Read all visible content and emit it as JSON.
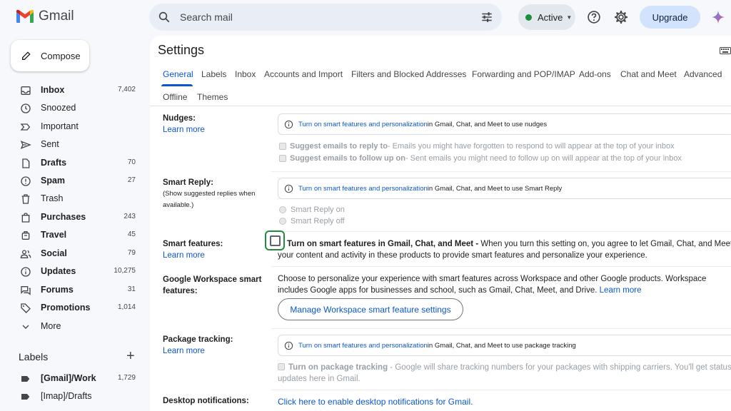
{
  "header": {
    "app_name": "Gmail",
    "search_placeholder": "Search mail",
    "status": "Active",
    "upgrade_label": "Upgrade"
  },
  "sidebar": {
    "compose_label": "Compose",
    "items": [
      {
        "label": "Inbox",
        "count": "7,402",
        "bold": true
      },
      {
        "label": "Snoozed",
        "count": "",
        "bold": false
      },
      {
        "label": "Important",
        "count": "",
        "bold": false
      },
      {
        "label": "Sent",
        "count": "",
        "bold": false
      },
      {
        "label": "Drafts",
        "count": "70",
        "bold": true
      },
      {
        "label": "Spam",
        "count": "27",
        "bold": true
      },
      {
        "label": "Trash",
        "count": "",
        "bold": false
      },
      {
        "label": "Purchases",
        "count": "243",
        "bold": true
      },
      {
        "label": "Travel",
        "count": "45",
        "bold": true
      },
      {
        "label": "Social",
        "count": "79",
        "bold": true
      },
      {
        "label": "Updates",
        "count": "10,275",
        "bold": true
      },
      {
        "label": "Forums",
        "count": "31",
        "bold": true
      },
      {
        "label": "Promotions",
        "count": "1,014",
        "bold": true
      },
      {
        "label": "More",
        "count": "",
        "bold": false
      }
    ],
    "labels_title": "Labels",
    "labels": [
      {
        "label": "[Gmail]/Work",
        "count": "1,729",
        "bold": true
      },
      {
        "label": "[Imap]/Drafts",
        "count": "",
        "bold": false
      }
    ]
  },
  "settings": {
    "title": "Settings",
    "tabs": [
      "General",
      "Labels",
      "Inbox",
      "Accounts and Import",
      "Filters and Blocked Addresses",
      "Forwarding and POP/IMAP",
      "Add-ons",
      "Chat and Meet",
      "Advanced",
      "Offline",
      "Themes"
    ],
    "learn_more": "Learn more",
    "smart_link": "Turn on smart features and personalization",
    "nudges": {
      "label": "Nudges:",
      "notice_suffix": " in Gmail, Chat, and Meet to use nudges",
      "opt1_bold": "Suggest emails to reply to",
      "opt1_text": " - Emails you might have forgotten to respond to will appear at the top of your inbox",
      "opt2_bold": "Suggest emails to follow up on",
      "opt2_text": " - Sent emails you might need to follow up on will appear at the top of your inbox"
    },
    "smart_reply": {
      "label": "Smart Reply:",
      "sub": "(Show suggested replies when available.)",
      "notice_suffix": " in Gmail, Chat, and Meet to use Smart Reply",
      "on": "Smart Reply on",
      "off": "Smart Reply off"
    },
    "smart_features": {
      "label": "Smart features:",
      "bold": "Turn on smart features in Gmail, Chat, and Meet -",
      "text": " When you turn this setting on, you agree to let Gmail, Chat, and Meet use your content and activity in these products to provide smart features and personalize your experience."
    },
    "workspace": {
      "label": "Google Workspace smart features:",
      "text": "Choose to personalize your experience with smart features across Workspace and other Google products. Workspace includes Google apps for businesses and school, such as Gmail, Chat, Meet, and Drive. ",
      "button": "Manage Workspace smart feature settings"
    },
    "package": {
      "label": "Package tracking:",
      "notice_suffix": " in Gmail, Chat, and Meet to use package tracking",
      "bold": "Turn on package tracking",
      "text": " - Google will share tracking numbers for your packages with shipping carriers. You'll get status updates here in Gmail."
    },
    "desktop": {
      "label": "Desktop notifications:",
      "link": "Click here to enable desktop notifications for Gmail."
    }
  },
  "colors": {
    "accent": "#0b57d0",
    "active_green": "#1e8e3e",
    "background": "#f6f8fc"
  }
}
